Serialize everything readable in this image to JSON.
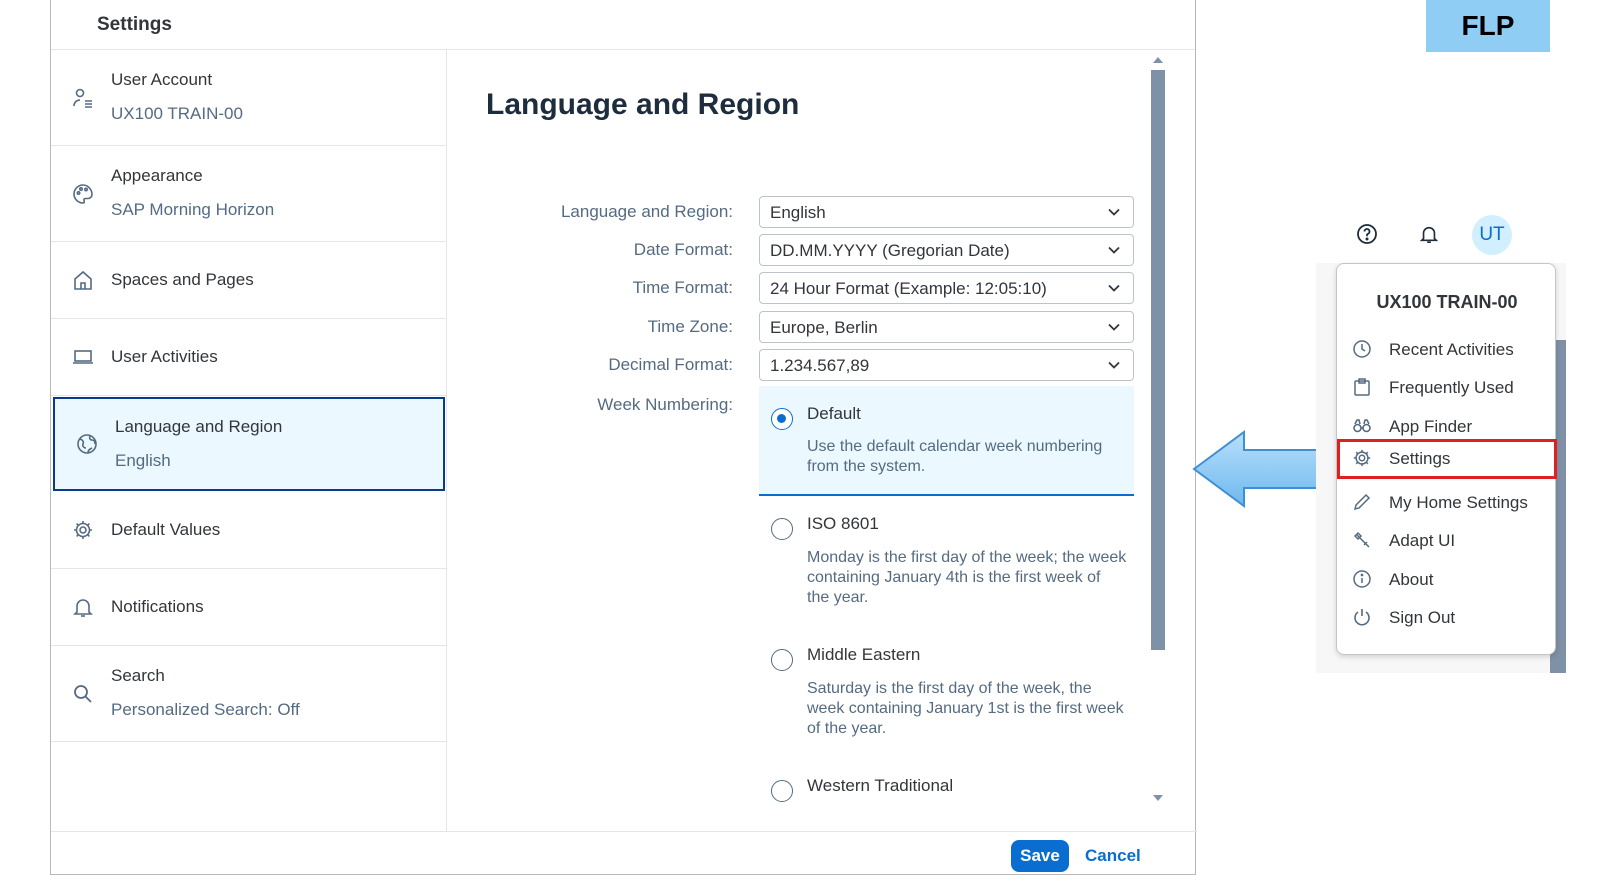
{
  "dialog": {
    "title": "Settings",
    "sidebar": [
      {
        "icon": "user-account-icon",
        "title": "User Account",
        "subtitle": "UX100 TRAIN-00"
      },
      {
        "icon": "palette-icon",
        "title": "Appearance",
        "subtitle": "SAP Morning Horizon"
      },
      {
        "icon": "home-icon",
        "title": "Spaces and Pages",
        "subtitle": ""
      },
      {
        "icon": "laptop-icon",
        "title": "User Activities",
        "subtitle": ""
      },
      {
        "icon": "globe-icon",
        "title": "Language and Region",
        "subtitle": "English"
      },
      {
        "icon": "gear-icon",
        "title": "Default Values",
        "subtitle": ""
      },
      {
        "icon": "bell-icon",
        "title": "Notifications",
        "subtitle": ""
      },
      {
        "icon": "search-icon",
        "title": "Search",
        "subtitle": "Personalized Search: Off"
      }
    ],
    "selected_item": "Language and Region",
    "content": {
      "heading": "Language and Region",
      "fields": [
        {
          "label": "Language and Region:",
          "value": "English"
        },
        {
          "label": "Date Format:",
          "value": "DD.MM.YYYY (Gregorian Date)"
        },
        {
          "label": "Time Format:",
          "value": "24 Hour Format (Example: 12:05:10)"
        },
        {
          "label": "Time Zone:",
          "value": "Europe, Berlin"
        },
        {
          "label": "Decimal Format:",
          "value": "1.234.567,89"
        }
      ],
      "week_numbering": {
        "label": "Week Numbering:",
        "options": [
          {
            "title": "Default",
            "desc": "Use the default calendar week numbering from the system.",
            "selected": true
          },
          {
            "title": "ISO 8601",
            "desc": "Monday is the first day of the week; the week containing January 4th is the first week of the year.",
            "selected": false
          },
          {
            "title": "Middle Eastern",
            "desc": "Saturday is the first day of the week, the week containing January 1st is the first week of the year.",
            "selected": false
          },
          {
            "title": "Western Traditional",
            "desc": "",
            "selected": false
          }
        ]
      }
    },
    "footer": {
      "save": "Save",
      "cancel": "Cancel"
    }
  },
  "badge": "FLP",
  "shell": {
    "avatar_initials": "UT",
    "user_name": "UX100 TRAIN-00",
    "menu": [
      {
        "icon": "recent-activities-icon",
        "label": "Recent Activities"
      },
      {
        "icon": "frequently-used-icon",
        "label": "Frequently Used"
      },
      {
        "icon": "app-finder-icon",
        "label": "App Finder"
      },
      {
        "icon": "gear-icon",
        "label": "Settings",
        "highlighted": true
      },
      {
        "icon": "pencil-icon",
        "label": "My Home Settings"
      },
      {
        "icon": "adapt-ui-icon",
        "label": "Adapt UI"
      },
      {
        "icon": "info-icon",
        "label": "About"
      },
      {
        "icon": "power-icon",
        "label": "Sign Out"
      }
    ]
  },
  "colors": {
    "accent": "#0a6ed1",
    "selected_border": "#0a3a8c",
    "highlight": "#e02020",
    "badge_bg": "#90cdf4",
    "arrow": "#8ccbf5"
  }
}
